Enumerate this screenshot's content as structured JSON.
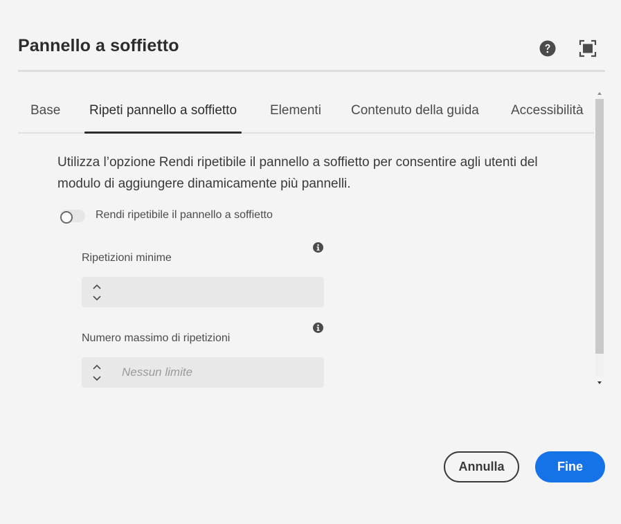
{
  "dialog": {
    "title": "Pannello a soffietto",
    "help_icon": "help-circle-icon",
    "fullscreen_icon": "fullscreen-icon"
  },
  "tabs": [
    {
      "label": "Base",
      "selected": false
    },
    {
      "label": "Ripeti pannello a soffietto",
      "selected": true
    },
    {
      "label": "Elementi",
      "selected": false
    },
    {
      "label": "Contenuto della guida",
      "selected": false
    },
    {
      "label": "Accessibilità",
      "selected": false
    }
  ],
  "content": {
    "description": "Utilizza l’opzione Rendi ripetibile il pannello a soffietto per consentire agli utenti del modulo di aggiungere dinamicamente più pannelli.",
    "repeatable_toggle": {
      "label": "Rendi ripetibile il pannello a soffietto",
      "checked": false
    },
    "min_repetitions": {
      "label": "Ripetizioni minime",
      "value": "",
      "placeholder": ""
    },
    "max_repetitions": {
      "label": "Numero massimo di ripetizioni",
      "value": "",
      "placeholder": "Nessun limite"
    }
  },
  "footer": {
    "cancel_label": "Annulla",
    "done_label": "Fine"
  },
  "colors": {
    "background": "#f4f4f4",
    "accent": "#1473e6",
    "text": "#2c2c2c",
    "field_bg": "#e8e8e8"
  }
}
